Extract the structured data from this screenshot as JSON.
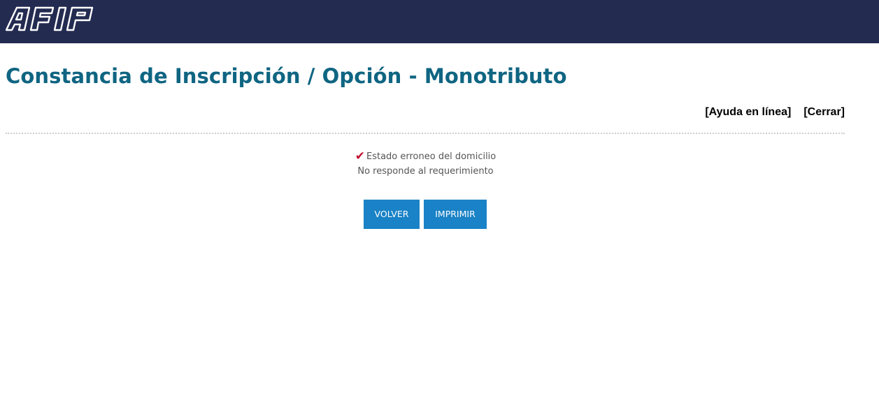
{
  "header": {
    "logo_text": "AFIP",
    "logo_icon": "afip-logo"
  },
  "main": {
    "title": "Constancia de Inscripción / Opción - Monotributo",
    "links": {
      "help": "[Ayuda en línea]",
      "close": "[Cerrar]"
    },
    "status": {
      "check_icon": "checkmark-icon",
      "line1": "Estado erroneo del domicilio",
      "line2": "No responde al requerimiento"
    },
    "buttons": {
      "back": "VOLVER",
      "print": "IMPRIMIR"
    }
  },
  "colors": {
    "header_bg": "#232b51",
    "title": "#0f6582",
    "button_bg": "#1a82c6",
    "check": "#c0102e"
  }
}
